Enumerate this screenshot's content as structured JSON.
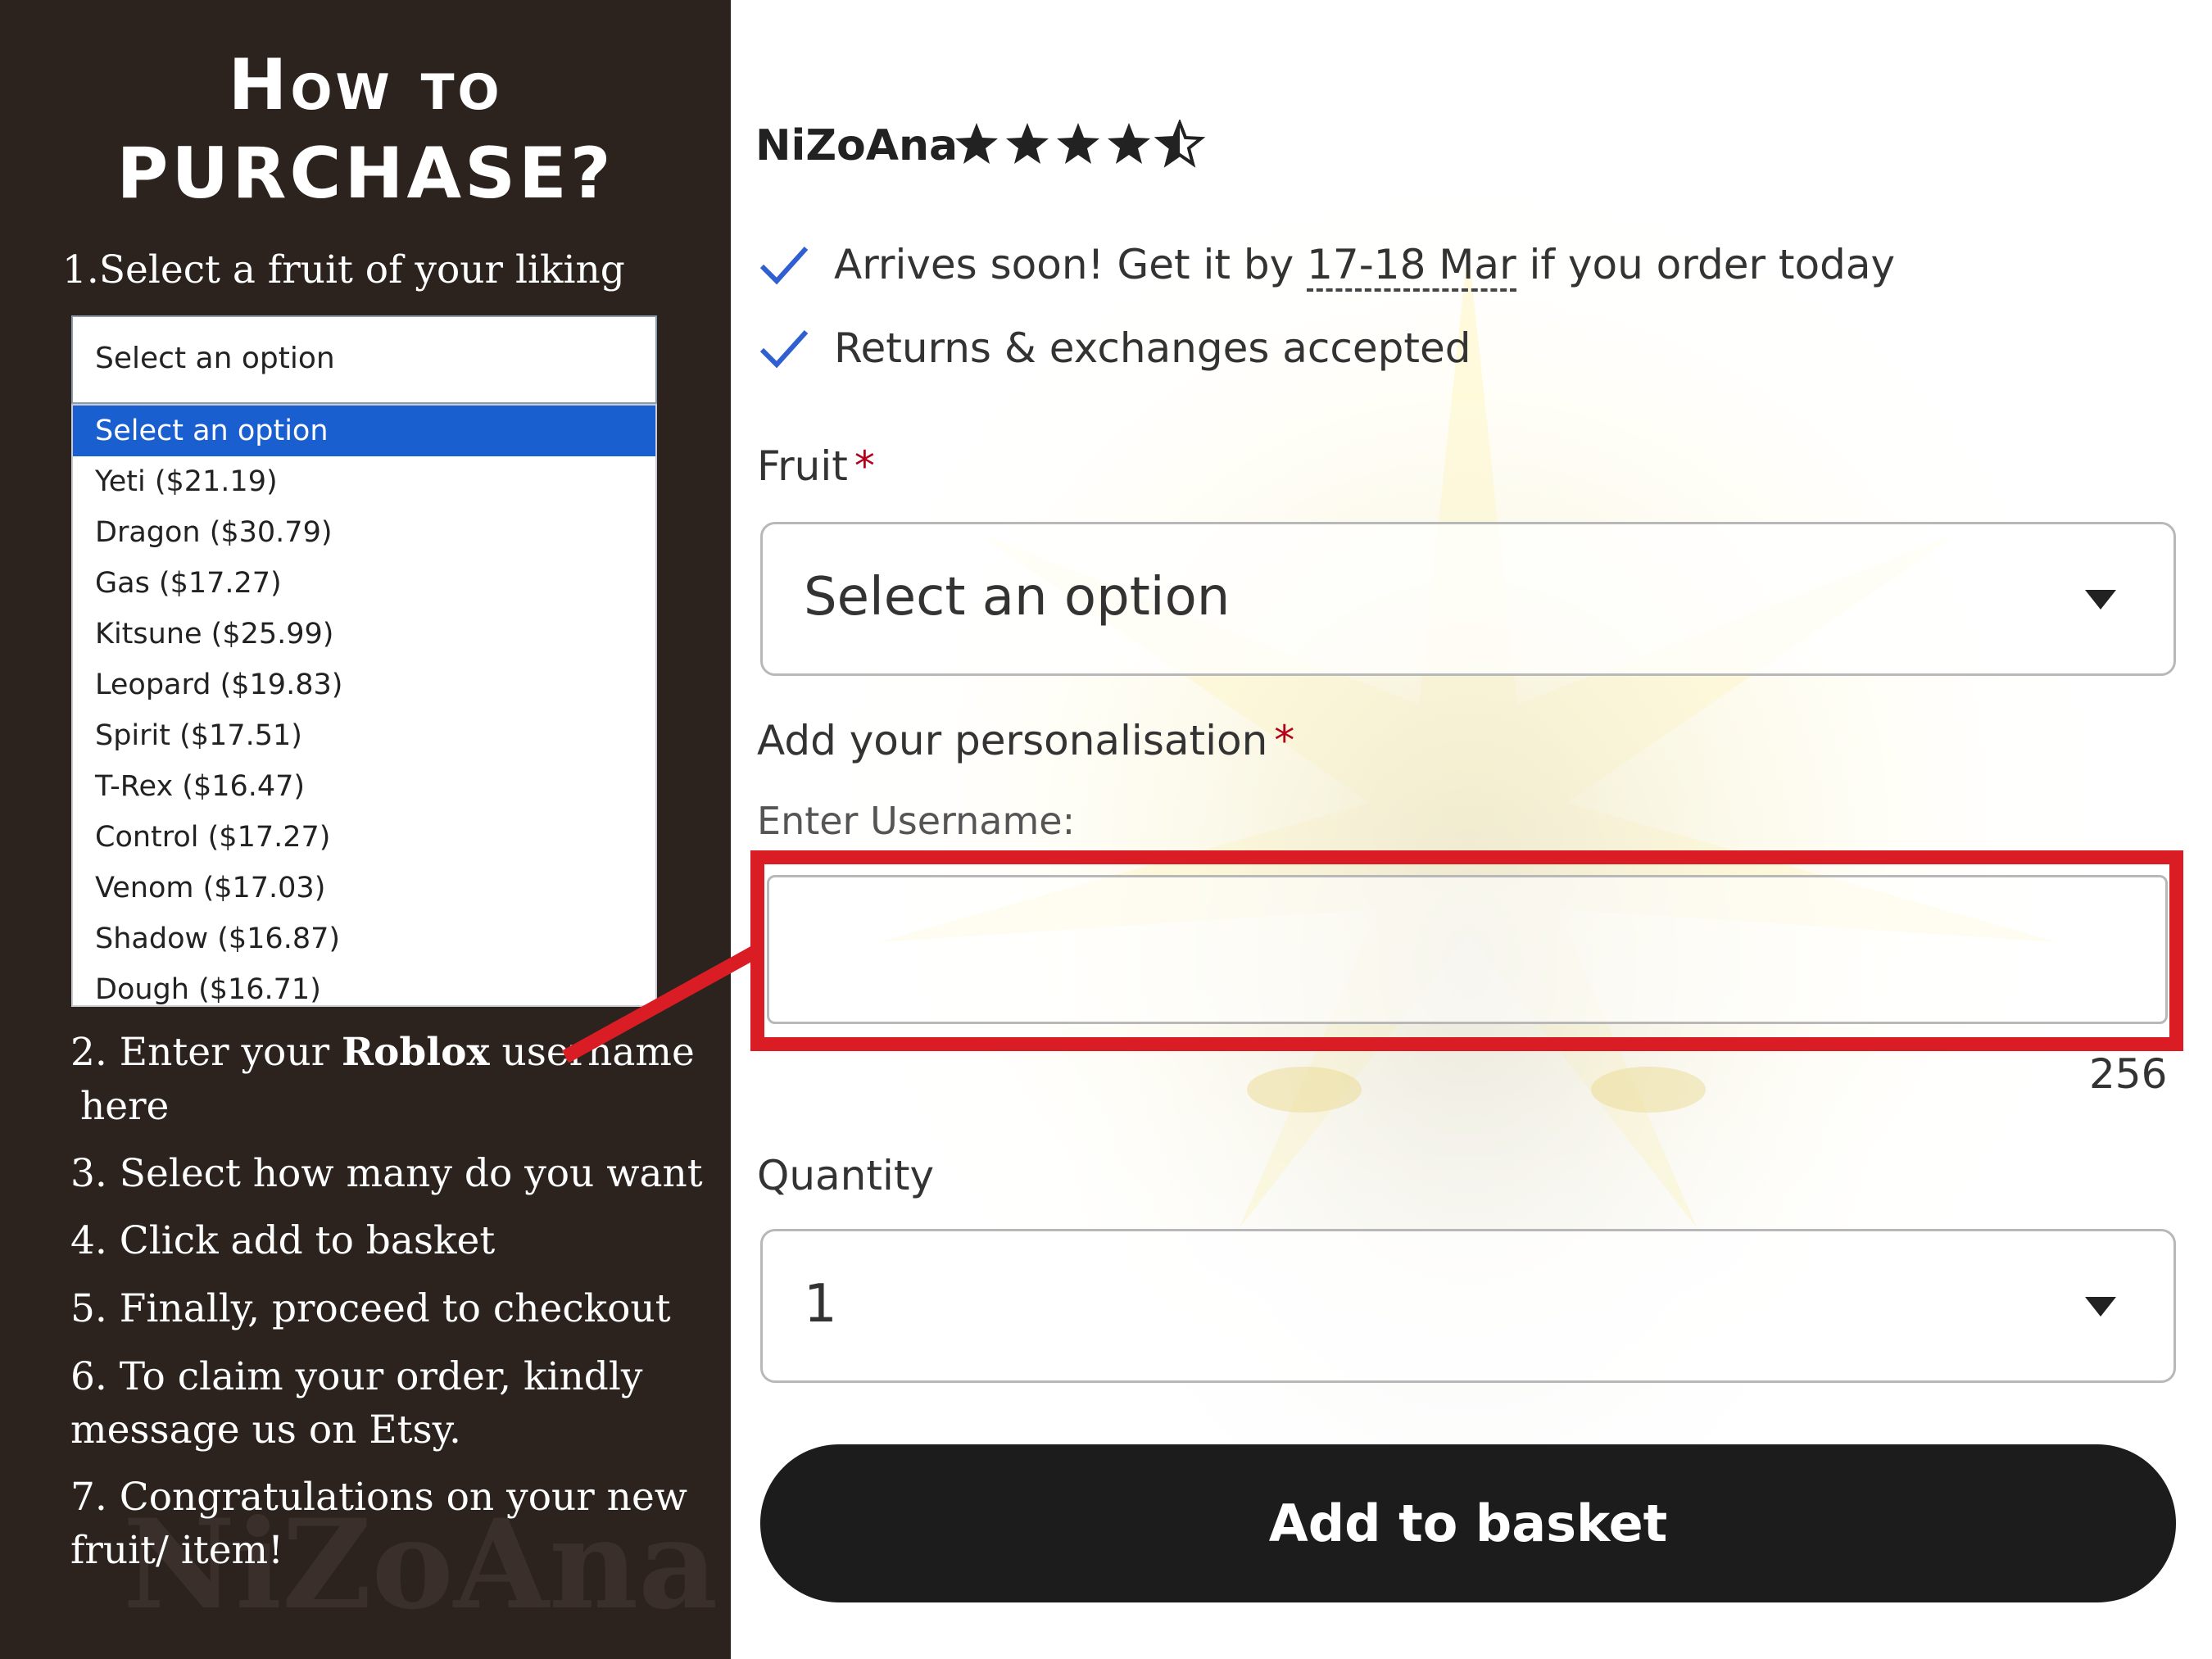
{
  "instructions": {
    "title_line1": "How to",
    "title_line2": "PURCHASE?",
    "step1": "1.Select a fruit of your liking",
    "step2_prefix": "2. Enter your ",
    "step2_bold": "Roblox",
    "step2_suffix": " username",
    "step2_line2": "here",
    "step3": "3. Select how many do you want",
    "step4": "4. Click add to basket",
    "step5": "5. Finally, proceed to checkout",
    "step6_line1": "6. To claim your order, kindly",
    "step6_line2": "message us on Etsy.",
    "step7_line1": "7. Congratulations on your new",
    "step7_line2": "fruit/ item!",
    "watermark": "NiZoAna"
  },
  "dropdown_demo": {
    "selected_value": "Select an option",
    "options": [
      "Select an option",
      "Yeti ($21.19)",
      "Dragon ($30.79)",
      "Gas ($17.27)",
      "Kitsune ($25.99)",
      "Leopard ($19.83)",
      "Spirit ($17.51)",
      "T-Rex ($16.47)",
      "Control ($17.27)",
      "Venom ($17.03)",
      "Shadow ($16.87)",
      "Dough ($16.71)"
    ]
  },
  "product": {
    "shop_name": "NiZoAna",
    "rating": 4.5,
    "rating_max": 5,
    "delivery_prefix": "Arrives soon! Get it by ",
    "delivery_date": "17-18 Mar",
    "delivery_suffix": " if you order today",
    "returns": "Returns & exchanges accepted",
    "fruit_label": "Fruit",
    "required_mark": "*",
    "fruit_value": "Select an option",
    "personalisation_label": "Add your personalisation",
    "username_label": "Enter Username:",
    "username_value": "",
    "char_count": "256",
    "quantity_label": "Quantity",
    "quantity_value": "1",
    "add_to_basket": "Add to basket"
  },
  "colors": {
    "left_panel": "#2c231f",
    "highlight": "#da1d25",
    "check": "#2f5fd0",
    "required": "#b3001b",
    "button": "#1c1c1c",
    "dropdown_selected": "#1a5fcf"
  },
  "icons": [
    "star-icon",
    "half-star-icon",
    "check-icon",
    "caret-down-icon"
  ]
}
